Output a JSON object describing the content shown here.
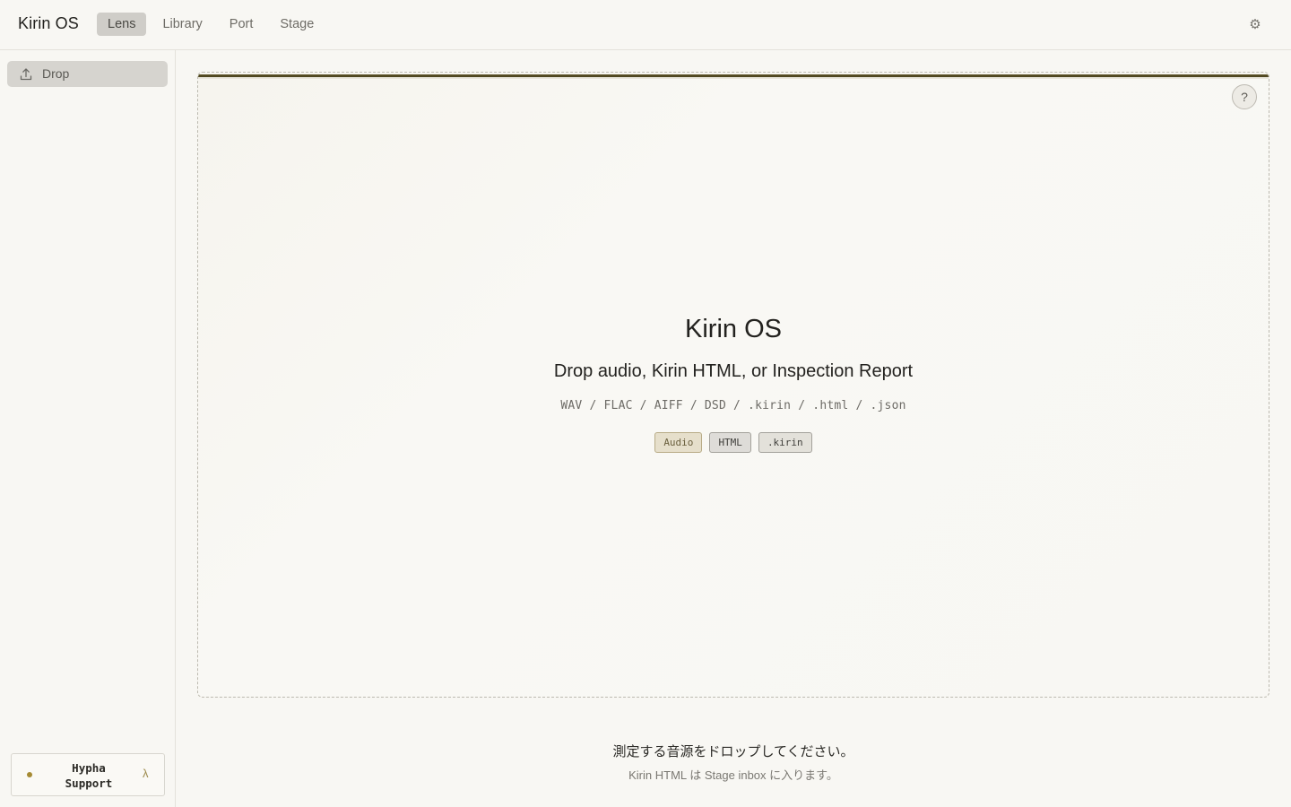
{
  "app": {
    "title": "Kirin OS"
  },
  "nav": {
    "tabs": [
      {
        "label": "Lens",
        "active": true
      },
      {
        "label": "Library",
        "active": false
      },
      {
        "label": "Port",
        "active": false
      },
      {
        "label": "Stage",
        "active": false
      }
    ],
    "settings_icon": "gear-icon"
  },
  "sidebar": {
    "items": [
      {
        "label": "Drop",
        "icon": "upload-icon",
        "active": true
      }
    ],
    "support": {
      "line1": "Hypha",
      "line2": "Support",
      "caret_icon": "λ",
      "status_color": "#a58a33"
    }
  },
  "dropzone": {
    "title": "Kirin OS",
    "subtitle": "Drop audio, Kirin HTML, or Inspection Report",
    "formats": "WAV / FLAC / AIFF / DSD / .kirin / .html / .json",
    "chips": [
      "Audio",
      "HTML",
      ".kirin"
    ],
    "help_label": "?"
  },
  "footer": {
    "main": "測定する音源をドロップしてください。",
    "sub": "Kirin HTML は Stage inbox に入ります。"
  },
  "colors": {
    "accent_bar": "#5c5326",
    "background": "#f8f7f3"
  }
}
